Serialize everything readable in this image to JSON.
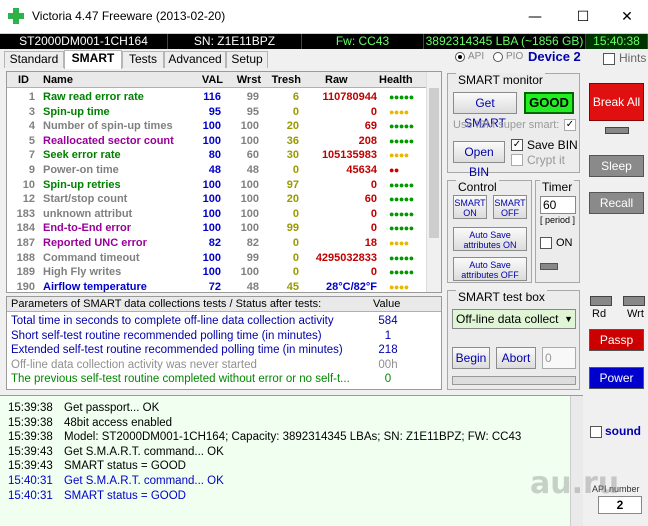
{
  "app": {
    "title": "Victoria 4.47  Freeware (2013-02-20)"
  },
  "window": {
    "minimize": "—",
    "maximize": "☐",
    "close": "✕"
  },
  "info": {
    "model": "ST2000DM001-1CH164",
    "serial": "SN: Z1E11BPZ",
    "firmware": "Fw: CC43",
    "capacity": "3892314345 LBA (~1856 GB)",
    "time": "15:40:38"
  },
  "tabs": [
    "Standard",
    "SMART",
    "Tests",
    "Advanced",
    "Setup"
  ],
  "api": {
    "api_label": "API",
    "pio_label": "PIO",
    "device": "Device 2",
    "hints": "Hints"
  },
  "table": {
    "headers": {
      "id": "ID",
      "name": "Name",
      "val": "VAL",
      "wrst": "Wrst",
      "tresh": "Tresh",
      "raw": "Raw",
      "health": "Health"
    },
    "rows": [
      {
        "id": "1",
        "name": "Raw read error rate",
        "val": "116",
        "wrst": "99",
        "tresh": "6",
        "raw": "110780944",
        "health": "●●●●●",
        "name_color": "#008000",
        "raw_color": "#c00000",
        "health_color": "#009900"
      },
      {
        "id": "3",
        "name": "Spin-up time",
        "val": "95",
        "wrst": "95",
        "tresh": "0",
        "raw": "0",
        "health": "●●●●",
        "name_color": "#008000",
        "raw_color": "#c00000",
        "health_color": "#e6b800"
      },
      {
        "id": "4",
        "name": "Number of spin-up times",
        "val": "100",
        "wrst": "100",
        "tresh": "20",
        "raw": "69",
        "health": "●●●●●",
        "name_color": "#808080",
        "raw_color": "#c00000",
        "health_color": "#009900"
      },
      {
        "id": "5",
        "name": "Reallocated sector count",
        "val": "100",
        "wrst": "100",
        "tresh": "36",
        "raw": "208",
        "health": "●●●●●",
        "name_color": "#990099",
        "raw_color": "#c00000",
        "health_color": "#009900"
      },
      {
        "id": "7",
        "name": "Seek error rate",
        "val": "80",
        "wrst": "60",
        "tresh": "30",
        "raw": "105135983",
        "health": "●●●●",
        "name_color": "#008000",
        "raw_color": "#c00000",
        "health_color": "#e6b800"
      },
      {
        "id": "9",
        "name": "Power-on time",
        "val": "48",
        "wrst": "48",
        "tresh": "0",
        "raw": "45634",
        "health": "●●",
        "name_color": "#808080",
        "raw_color": "#c00000",
        "health_color": "#cc0000"
      },
      {
        "id": "10",
        "name": "Spin-up retries",
        "val": "100",
        "wrst": "100",
        "tresh": "97",
        "raw": "0",
        "health": "●●●●●",
        "name_color": "#008000",
        "raw_color": "#c00000",
        "health_color": "#009900"
      },
      {
        "id": "12",
        "name": "Start/stop count",
        "val": "100",
        "wrst": "100",
        "tresh": "20",
        "raw": "60",
        "health": "●●●●●",
        "name_color": "#808080",
        "raw_color": "#c00000",
        "health_color": "#009900"
      },
      {
        "id": "183",
        "name": "unknown attribut",
        "val": "100",
        "wrst": "100",
        "tresh": "0",
        "raw": "0",
        "health": "●●●●●",
        "name_color": "#808080",
        "raw_color": "#c00000",
        "health_color": "#009900"
      },
      {
        "id": "184",
        "name": "End-to-End error",
        "val": "100",
        "wrst": "100",
        "tresh": "99",
        "raw": "0",
        "health": "●●●●●",
        "name_color": "#990099",
        "raw_color": "#c00000",
        "health_color": "#009900"
      },
      {
        "id": "187",
        "name": "Reported UNC error",
        "val": "82",
        "wrst": "82",
        "tresh": "0",
        "raw": "18",
        "health": "●●●●",
        "name_color": "#990099",
        "raw_color": "#c00000",
        "health_color": "#e6b800"
      },
      {
        "id": "188",
        "name": "Command timeout",
        "val": "100",
        "wrst": "99",
        "tresh": "0",
        "raw": "4295032833",
        "health": "●●●●●",
        "name_color": "#808080",
        "raw_color": "#c00000",
        "health_color": "#009900"
      },
      {
        "id": "189",
        "name": "High Fly writes",
        "val": "100",
        "wrst": "100",
        "tresh": "0",
        "raw": "0",
        "health": "●●●●●",
        "name_color": "#808080",
        "raw_color": "#c00000",
        "health_color": "#009900"
      },
      {
        "id": "190",
        "name": "Airflow temperature",
        "val": "72",
        "wrst": "48",
        "tresh": "45",
        "raw": "28°C/82°F",
        "health": "●●●●",
        "name_color": "#0000cc",
        "raw_color": "#0000cc",
        "health_color": "#e6b800"
      }
    ]
  },
  "params": {
    "header": "Parameters of SMART data collections tests / Status after tests:",
    "value_header": "Value",
    "rows": [
      {
        "label": "Total time in seconds to complete off-line data collection activity",
        "value": "584",
        "color": "#0000aa"
      },
      {
        "label": "Short self-test routine recommended polling time (in minutes)",
        "value": "1",
        "color": "#0000aa"
      },
      {
        "label": "Extended self-test routine recommended polling time (in minutes)",
        "value": "218",
        "color": "#0000aa"
      },
      {
        "label": "Off-line data collection activity was never started",
        "value": "00h",
        "color": "#909090"
      },
      {
        "label": "The previous self-test routine completed without error or no self-t...",
        "value": "0",
        "color": "#008800"
      }
    ]
  },
  "log": [
    {
      "time": "15:39:38",
      "text": "Get passport... OK",
      "color": "#000000"
    },
    {
      "time": "15:39:38",
      "text": "48bit access enabled",
      "color": "#000000"
    },
    {
      "time": "15:39:38",
      "text": "Model: ST2000DM001-1CH164; Capacity: 3892314345 LBAs; SN: Z1E11BPZ; FW: CC43",
      "color": "#000000"
    },
    {
      "time": "15:39:43",
      "text": "Get S.M.A.R.T. command... OK",
      "color": "#000000"
    },
    {
      "time": "15:39:43",
      "text": "SMART status = GOOD",
      "color": "#000000"
    },
    {
      "time": "15:40:31",
      "text": "Get S.M.A.R.T. command... OK",
      "color": "#0000cc"
    },
    {
      "time": "15:40:31",
      "text": "SMART status = GOOD",
      "color": "#0000cc"
    }
  ],
  "smart_monitor": {
    "title": "SMART monitor",
    "get_smart": "Get SMART",
    "status": "GOOD",
    "use_ibm": "Use IBM super smart:",
    "open_bin": "Open BIN",
    "save_bin": "Save BIN",
    "crypt_it": "Crypt it"
  },
  "control": {
    "title": "Control",
    "smart_on": "SMART ON",
    "smart_off": "SMART OFF",
    "autosave_on": "Auto Save attributes ON",
    "autosave_off": "Auto Save attributes OFF"
  },
  "timer": {
    "title": "Timer",
    "value": "60",
    "period": "[ period ]",
    "on_label": "ON"
  },
  "test_box": {
    "title": "SMART test box",
    "selected": "Off-line data collect",
    "begin": "Begin",
    "abort": "Abort",
    "number": "0"
  },
  "side": {
    "break_all": "Break All",
    "sleep": "Sleep",
    "recall": "Recall",
    "rd": "Rd",
    "wrt": "Wrt",
    "passp": "Passp",
    "power": "Power",
    "sound": "sound",
    "api_number_label": "API number",
    "api_number": "2"
  },
  "watermark": "au.ru"
}
